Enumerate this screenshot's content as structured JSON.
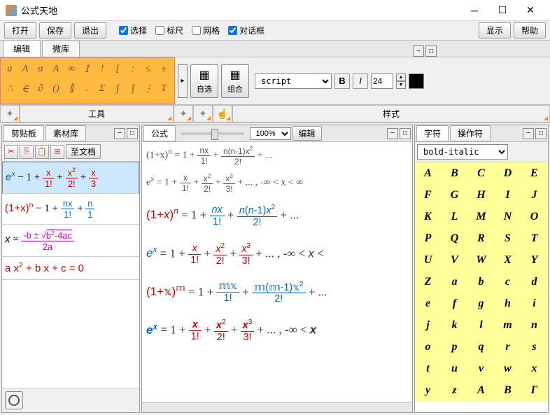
{
  "window": {
    "title": "公式天地"
  },
  "toolbar": {
    "open": "打开",
    "save": "保存",
    "exit": "退出",
    "select": "选择",
    "ruler": "标尺",
    "grid": "网格",
    "dialog": "对话框",
    "show": "显示",
    "help": "帮助"
  },
  "tabs": {
    "edit": "编辑",
    "microlib": "微库"
  },
  "palette": {
    "row1": [
      "a",
      "A",
      "α",
      "A",
      "∞",
      "Ⅰ",
      "!",
      "[",
      ":",
      "≤",
      "±"
    ],
    "row2": [
      "∴",
      "∈",
      "∂",
      "()",
      "∥",
      ".",
      "Σ",
      "∫",
      "∫",
      "⋮",
      "T"
    ]
  },
  "bigbtns": {
    "auto": "自选",
    "combo": "组合"
  },
  "font": {
    "name": "script",
    "bold": "B",
    "italic": "I",
    "size": "24"
  },
  "stylerow": {
    "tools": "工具",
    "style": "样式"
  },
  "left": {
    "tabs": {
      "clipboard": "剪贴板",
      "matlib": "素材库"
    },
    "todoc": "至文档",
    "items": [
      {
        "html": "<i class='b'>e</i><sup class='b'>x</sup> − 1 + <span class='frac r'><span class='n'>x</span><span class='d'>1!</span></span> + <span class='frac r'><span class='n'>x<sup>2</sup></span><span class='d'>2!</span></span> + <span class='frac r'><span class='n'>x</span><span class='d'>3</span></span>",
        "sel": true
      },
      {
        "html": "<span class='r'>(1+x)</span><sup class='r'>n</sup> − 1 + <span class='frac b'><span class='n'>nx</span><span class='d'>1!</span></span> + <span class='frac b'><span class='n'>n</span><span class='d'>1</span></span>"
      },
      {
        "html": "<i>x</i> = <span class='frac m'><span class='n'>-b ± √<span style='text-decoration:overline'>b<sup>2</sup>-4ac</span></span><span class='d'>2a</span></span>"
      },
      {
        "html": "<span class='r'>a x<sup>2</sup> + b x + c = 0</span>"
      }
    ]
  },
  "center": {
    "tab": "公式",
    "zoom": "100%",
    "edit": "编辑",
    "small": [
      "(1+x)<sup>n</sup> = 1 + <span class='frac'><span class='n'>nx</span><span class='d'>1!</span></span> + <span class='frac'><span class='n'>n(n-1)x<sup>2</sup></span><span class='d'>2!</span></span> + ...",
      "e<sup>x</sup> = 1 + <span class='frac'><span class='n'>x</span><span class='d'>1!</span></span> + <span class='frac'><span class='n'>x<sup>2</sup></span><span class='d'>2!</span></span> + <span class='frac'><span class='n'>x<sup>3</sup></span><span class='d'>3!</span></span> + ... , -∞ < x < ∞"
    ],
    "big": [
      "<span class='r'>(1+<i>x</i>)<sup><i>n</i></sup></span> = 1 + <span class='frac b'><span class='n'><i>nx</i></span><span class='d'>1!</span></span> + <span class='frac b'><span class='n'><i>n</i>(<i>n</i>-1)<i>x</i><sup>2</sup></span><span class='d'>2!</span></span> + ...",
      "<span class='b'><i>e</i><sup><i>x</i></sup></span> = 1 + <span class='frac r'><span class='n'><i>x</i></span><span class='d'>1!</span></span> + <span class='frac r'><span class='n'><i>x</i><sup>2</sup></span><span class='d'>2!</span></span> + <span class='frac r'><span class='n'><i>x</i><sup>3</sup></span><span class='d'>3!</span></span> + ... , -∞ &lt; <i>x</i> &lt;",
      "<span class='r'>(1+𝕩)<sup>𝕞</sup></span> = 1 + <span class='frac b'><span class='n'>𝕞𝕩</span><span class='d'>1!</span></span> + <span class='frac b'><span class='n'>𝕞(𝕞-1)𝕩<sup>2</sup></span><span class='d'>2!</span></span> + ...",
      "<span class='b'><b><i>e</i><sup><i>x</i></sup></b></span> = 1 + <span class='frac r'><span class='n'><b><i>x</i></b></span><span class='d'>1!</span></span> + <span class='frac r'><span class='n'><b><i>x</i></b><sup>2</sup></span><span class='d'>2!</span></span> + <span class='frac r'><span class='n'><b><i>x</i></b><sup>3</sup></span><span class='d'>3!</span></span> + ... , -∞ &lt; <b><i>x</i></b>"
    ]
  },
  "right": {
    "tabs": {
      "chars": "字符",
      "ops": "操作符"
    },
    "font": "bold-italic",
    "grid": [
      "A",
      "B",
      "C",
      "D",
      "E",
      "F",
      "G",
      "H",
      "I",
      "J",
      "K",
      "L",
      "M",
      "N",
      "O",
      "P",
      "Q",
      "R",
      "S",
      "T",
      "U",
      "V",
      "W",
      "X",
      "Y",
      "Z",
      "a",
      "b",
      "c",
      "d",
      "e",
      "f",
      "g",
      "h",
      "i",
      "j",
      "k",
      "l",
      "m",
      "n",
      "o",
      "p",
      "q",
      "r",
      "s",
      "t",
      "u",
      "v",
      "w",
      "x",
      "y",
      "z",
      "A",
      "B",
      "Γ"
    ]
  }
}
